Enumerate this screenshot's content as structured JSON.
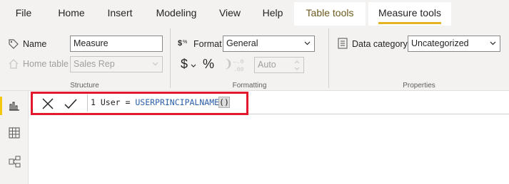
{
  "menu": {
    "items": [
      "File",
      "Home",
      "Insert",
      "Modeling",
      "View",
      "Help"
    ],
    "context_tabs": [
      "Table tools",
      "Measure tools"
    ],
    "active_tab": "Measure tools"
  },
  "ribbon": {
    "structure": {
      "name_label": "Name",
      "name_value": "Measure",
      "home_table_label": "Home table",
      "home_table_value": "Sales Rep",
      "group_label": "Structure"
    },
    "formatting": {
      "format_label": "Format",
      "format_value": "General",
      "currency_symbol": "$",
      "percent_symbol": "%",
      "comma_symbol": "❩",
      "decimals_value": "Auto",
      "group_label": "Formatting"
    },
    "properties": {
      "data_category_label": "Data category",
      "data_category_value": "Uncategorized",
      "group_label": "Properties"
    }
  },
  "rail": {
    "items": [
      "report-view-icon",
      "data-view-icon",
      "model-view-icon"
    ],
    "active": "report-view-icon"
  },
  "formula_bar": {
    "line_number": "1",
    "code_prefix": "User = ",
    "code_function": "USERPRINCIPALNAME",
    "code_parens": "()"
  },
  "colors": {
    "accent_underline": "#e5b423",
    "highlight_box": "#e3182d",
    "function_color": "#2a5fa8",
    "rail_active": "#f2c811"
  }
}
